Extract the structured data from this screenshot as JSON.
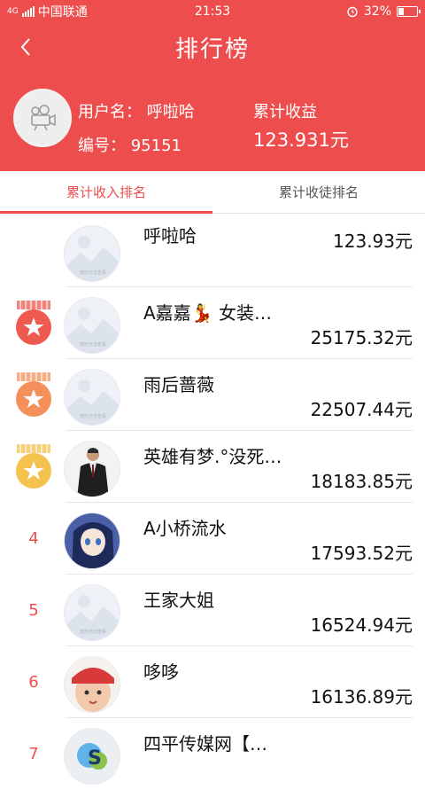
{
  "status_bar": {
    "network": "4G",
    "carrier": "中国联通",
    "time": "21:53",
    "battery": "32%",
    "battery_level": 0.32
  },
  "header": {
    "title": "排行榜",
    "username_label": "用户名：",
    "username": "呼啦哈",
    "id_label": "编号：",
    "id": "95151",
    "earnings_label": "累计收益",
    "earnings_value": "123.931元"
  },
  "tabs": [
    {
      "label": "累计收入排名",
      "active": true
    },
    {
      "label": "累计收徒排名",
      "active": false
    }
  ],
  "rows": [
    {
      "rank": "",
      "name": "呼啦哈",
      "amount": "123.93元",
      "avatar": "placeholder-image-icon"
    },
    {
      "rank": "",
      "medal": "#ee5a50",
      "name": "A嘉嘉💃 女装…",
      "amount": "25175.32元",
      "avatar": "placeholder-image-icon"
    },
    {
      "rank": "",
      "medal": "#f5905a",
      "name": "雨后蔷薇",
      "amount": "22507.44元",
      "avatar": "placeholder-image-icon"
    },
    {
      "rank": "",
      "medal": "#f4c24e",
      "name": "英雄有梦.°没死…",
      "amount": "18183.85元",
      "avatar": "suit-man-photo"
    },
    {
      "rank": "4",
      "name": "A小桥流水",
      "amount": "17593.52元",
      "avatar": "anime-girl-photo"
    },
    {
      "rank": "5",
      "name": "王家大姐",
      "amount": "16524.94元",
      "avatar": "placeholder-image-icon"
    },
    {
      "rank": "6",
      "name": "哆哆",
      "amount": "16136.89元",
      "avatar": "baby-photo"
    },
    {
      "rank": "7",
      "name": "四平传媒网【…",
      "amount": "",
      "avatar": "logo-photo"
    }
  ],
  "placeholder_caption": "暂时无法查看",
  "colors": {
    "accent": "#ee4d4d",
    "medal_1": "#ee5a50",
    "medal_2": "#f5905a",
    "medal_3": "#f4c24e"
  }
}
